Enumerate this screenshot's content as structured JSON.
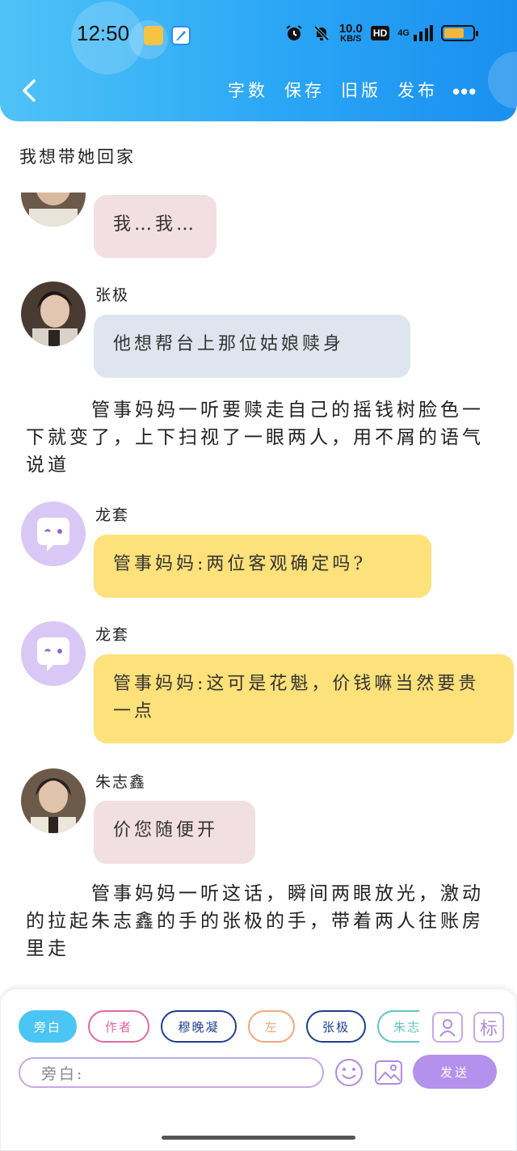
{
  "status_bar": {
    "time": "12:50",
    "speed_value": "10.0",
    "speed_unit": "KB/S",
    "hd": "HD",
    "network": "4G",
    "battery_level": 0.7
  },
  "nav": {
    "items": [
      "字数",
      "保存",
      "旧版",
      "发布"
    ],
    "more": "•••"
  },
  "chat": {
    "header_line": "我想带她回家",
    "msg1": {
      "text": "我…我…"
    },
    "msg2": {
      "speaker": "张极",
      "text": "他想帮台上那位姑娘赎身"
    },
    "narration1": "　　　管事妈妈一听要赎走自己的摇钱树脸色一下就变了，上下扫视了一眼两人，用不屑的语气说道",
    "msg3": {
      "speaker": "龙套",
      "text": "管事妈妈:两位客观确定吗?"
    },
    "msg4": {
      "speaker": "龙套",
      "text": "管事妈妈:这可是花魁，价钱嘛当然要贵一点"
    },
    "msg5": {
      "speaker": "朱志鑫",
      "text": "价您随便开"
    },
    "narration2": "　　　管事妈妈一听这话，瞬间两眼放光，激动的拉起朱志鑫的手的张极的手，带着两人往账房里走"
  },
  "composer": {
    "chips": [
      "旁白",
      "作者",
      "穆晚凝",
      "左",
      "张极",
      "朱志"
    ],
    "mark_label": "标",
    "input_placeholder": "旁白:",
    "send_label": "发送"
  },
  "colors": {
    "header": "#2aa6f5",
    "bubble_pink": "#f2dfe3",
    "bubble_gray": "#dfe5ee",
    "bubble_yellow": "#fde17a",
    "accent_purple": "#b391ec"
  }
}
